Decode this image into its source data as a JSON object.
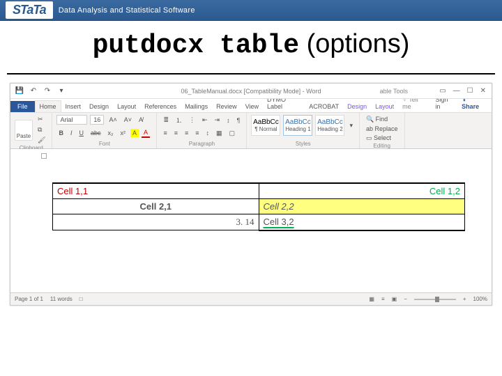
{
  "banner": {
    "logo": "STaTa",
    "tagline": "Data Analysis and Statistical Software"
  },
  "slide": {
    "title_cmd": "putdocx table",
    "title_options": " (options)"
  },
  "word": {
    "docname": "06_TableManual.docx [Compatibility Mode] - Word",
    "context_tool": "able Tools",
    "wincontrols": {
      "min": "▭",
      "restore": "—",
      "close": "☐"
    },
    "tabs": {
      "file": "File",
      "home": "Home",
      "insert": "Insert",
      "design": "Design",
      "layout": "Layout",
      "references": "References",
      "mailings": "Mailings",
      "review": "Review",
      "view": "View",
      "dymo": "DYMO Label",
      "acrobat": "ACROBAT",
      "tdesign": "Design",
      "tlayout": "Layout",
      "tellme": "♀ Tell me",
      "signin": "Sign in",
      "share": "⇪ Share"
    },
    "ribbon": {
      "clipboard": {
        "paste": "Paste",
        "label": "Clipboard"
      },
      "font": {
        "name": "Arial",
        "size": "16",
        "grow": "A˄",
        "shrink": "A˅",
        "clear": "A̸",
        "bold": "B",
        "italic": "I",
        "underline": "U",
        "strike": "abc",
        "sub": "x₂",
        "sup": "x²",
        "highlight": "A",
        "color": "A",
        "label": "Font"
      },
      "paragraph": {
        "label": "Paragraph"
      },
      "styles": {
        "preview": "AaBbCc",
        "normal": "¶ Normal",
        "h1": "Heading 1",
        "h2": "Heading 2",
        "label": "Styles"
      },
      "editing": {
        "find": "🔍 Find",
        "replace": "ab Replace",
        "select": "▭ Select",
        "label": "Editing"
      }
    },
    "table": {
      "r1c1": "Cell 1,1",
      "r1c2": "Cell 1,2",
      "r2c1": "Cell 2,1",
      "r2c2": "Cell 2,2",
      "r3c1": "3. 14",
      "r3c2": "Cell 3,2"
    },
    "status": {
      "page": "Page 1 of 1",
      "words": "11 words",
      "lang": "□",
      "readmode": "▦",
      "print": "≡",
      "web": "▣",
      "zoom_out": "−",
      "zoom_in": "+",
      "zoom": "100%"
    }
  }
}
